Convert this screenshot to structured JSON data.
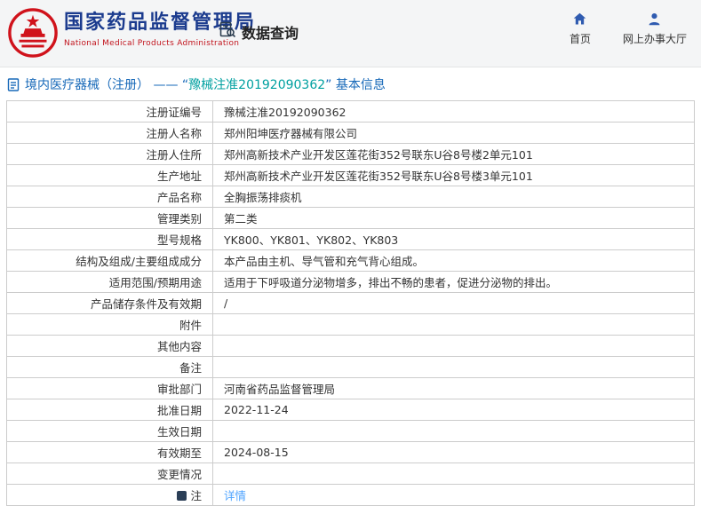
{
  "header": {
    "agency_name": "国家药品监督管理局",
    "agency_name_en": "National Medical Products Administration",
    "nav_data_query": "数据查询",
    "nav_home": "首页",
    "nav_service_hall": "网上办事大厅"
  },
  "page_title": {
    "prefix": "境内医疗器械（注册） —— “",
    "reg_number": "豫械注准20192090362",
    "suffix": "” 基本信息"
  },
  "icons": {
    "logo": "national-emblem",
    "data_query": "document-magnifier-icon",
    "home": "home-icon",
    "service_hall": "person-icon",
    "title": "document-icon",
    "note": "note-badge-icon"
  },
  "colors": {
    "header_bg": "#f4f5f6",
    "brand_blue": "#1b3b8e",
    "brand_red": "#c2151e",
    "title_blue": "#1668b8",
    "reg_number_teal": "#00a0a0",
    "table_border": "#cccccc",
    "link_blue": "#4da3ff",
    "nav_icon_blue": "#2f5bb0"
  },
  "table": {
    "rows": [
      {
        "label": "注册证编号",
        "value": "豫械注准20192090362"
      },
      {
        "label": "注册人名称",
        "value": "郑州阳坤医疗器械有限公司"
      },
      {
        "label": "注册人住所",
        "value": "郑州高新技术产业开发区莲花街352号联东U谷8号楼2单元101"
      },
      {
        "label": "生产地址",
        "value": "郑州高新技术产业开发区莲花街352号联东U谷8号楼3单元101"
      },
      {
        "label": "产品名称",
        "value": "全胸振荡排痰机"
      },
      {
        "label": "管理类别",
        "value": "第二类"
      },
      {
        "label": "型号规格",
        "value": "YK800、YK801、YK802、YK803"
      },
      {
        "label": "结构及组成/主要组成成分",
        "value": "本产品由主机、导气管和充气背心组成。"
      },
      {
        "label": "适用范围/预期用途",
        "value": "适用于下呼吸道分泌物增多，排出不畅的患者，促进分泌物的排出。"
      },
      {
        "label": "产品储存条件及有效期",
        "value": "/"
      },
      {
        "label": "附件",
        "value": ""
      },
      {
        "label": "其他内容",
        "value": ""
      },
      {
        "label": "备注",
        "value": ""
      },
      {
        "label": "审批部门",
        "value": "河南省药品监督管理局"
      },
      {
        "label": "批准日期",
        "value": "2022-11-24"
      },
      {
        "label": "生效日期",
        "value": ""
      },
      {
        "label": "有效期至",
        "value": "2024-08-15"
      },
      {
        "label": "变更情况",
        "value": ""
      },
      {
        "label": "注",
        "value": "详情"
      }
    ]
  }
}
